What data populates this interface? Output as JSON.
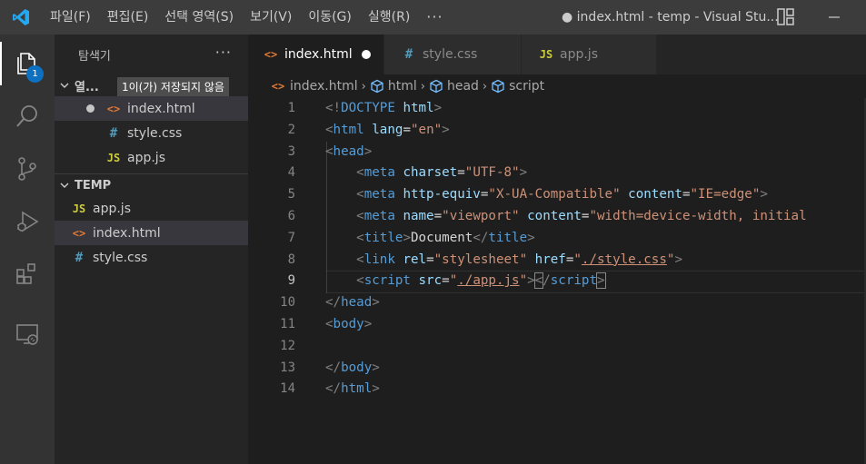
{
  "titlebar": {
    "menu": [
      "파일(F)",
      "편집(E)",
      "선택 영역(S)",
      "보기(V)",
      "이동(G)",
      "실행(R)",
      "···"
    ],
    "window_title": "● index.html - temp - Visual Stu..."
  },
  "activity": {
    "items": [
      "explorer-icon",
      "search-icon",
      "source-control-icon",
      "run-debug-icon",
      "extensions-icon",
      "remote-explorer-icon"
    ],
    "explorer_badge": "1"
  },
  "sidebar": {
    "title": "탐색기",
    "more": "···",
    "open_editors": {
      "label": "열...",
      "tooltip": "1이(가) 저장되지 않음",
      "files": [
        {
          "name": "index.html",
          "icon": "<>",
          "dirty": true
        },
        {
          "name": "style.css",
          "icon": "#"
        },
        {
          "name": "app.js",
          "icon": "JS"
        }
      ]
    },
    "folder": {
      "label": "TEMP",
      "files": [
        {
          "name": "app.js",
          "icon": "JS"
        },
        {
          "name": "index.html",
          "icon": "<>"
        },
        {
          "name": "style.css",
          "icon": "#"
        }
      ]
    }
  },
  "tabs": [
    {
      "label": "index.html",
      "icon": "<>",
      "active": true,
      "dirty": true
    },
    {
      "label": "style.css",
      "icon": "#"
    },
    {
      "label": "app.js",
      "icon": "JS"
    }
  ],
  "breadcrumb": {
    "file": "index.html",
    "items": [
      "html",
      "head",
      "script"
    ]
  },
  "editor": {
    "current_line": 9,
    "line_numbers": [
      "1",
      "2",
      "3",
      "4",
      "5",
      "6",
      "7",
      "8",
      "9",
      "10",
      "11",
      "12",
      "13",
      "14"
    ],
    "tokens": {
      "doctype": "DOCTYPE",
      "html": "html",
      "lang": "lang",
      "en": "\"en\"",
      "head": "head",
      "meta": "meta",
      "charset": "charset",
      "utf8": "\"UTF-8\"",
      "http_equiv": "http-equiv",
      "xua": "\"X-UA-Compatible\"",
      "content": "content",
      "ie_edge": "\"IE=edge\"",
      "name": "name",
      "viewport": "\"viewport\"",
      "viewport_content": "\"width=device-width, initial",
      "title": "title",
      "document": "Document",
      "link": "link",
      "rel": "rel",
      "stylesheet": "\"stylesheet\"",
      "href": "href",
      "style_path": "./style.css",
      "script": "script",
      "src": "src",
      "app_path": "./app.js",
      "body": "body"
    }
  },
  "colors": {
    "tag": "#569cd6",
    "attribute": "#9cdcfe",
    "string": "#ce9178",
    "bracket": "#808080",
    "badge": "#0e70c0",
    "title_bar": "#3c3c3c",
    "activity_bar": "#333333",
    "sidebar": "#252526",
    "editor": "#1e1e1e"
  }
}
